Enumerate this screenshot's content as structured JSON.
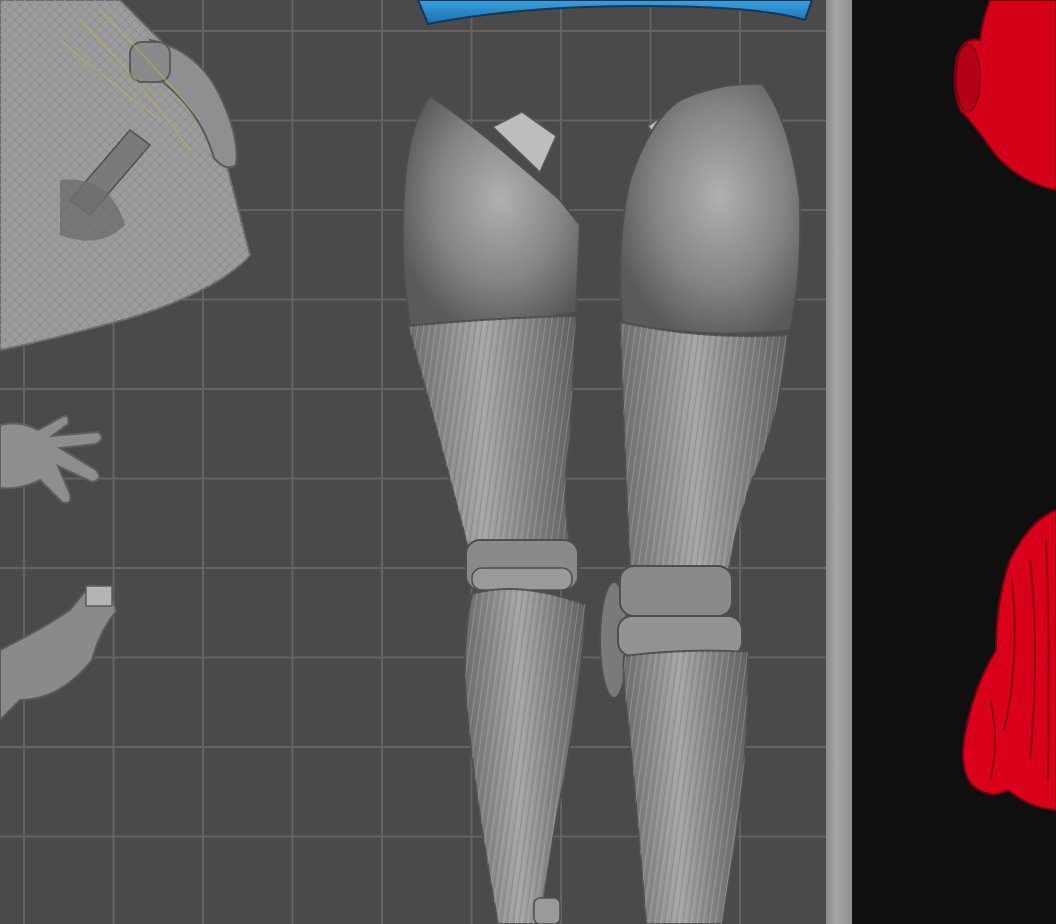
{
  "scene": {
    "view": "3d-slicer-build-plate",
    "grid": true,
    "colors": {
      "plate_background": "#4a4a4a",
      "grid_lines": "#636363",
      "model_gray": "#8c8c8c",
      "selected_part_blue": "#2d8fd0",
      "off_plate_red": "#d8001a",
      "outside_area": "#0f0f10"
    },
    "objects_on_plate": [
      "legs-pair",
      "dress-skirt-part",
      "hand-left",
      "arm-part",
      "blue-skirt-part"
    ],
    "objects_outside_plate": [
      "head-red",
      "hair-red"
    ]
  }
}
